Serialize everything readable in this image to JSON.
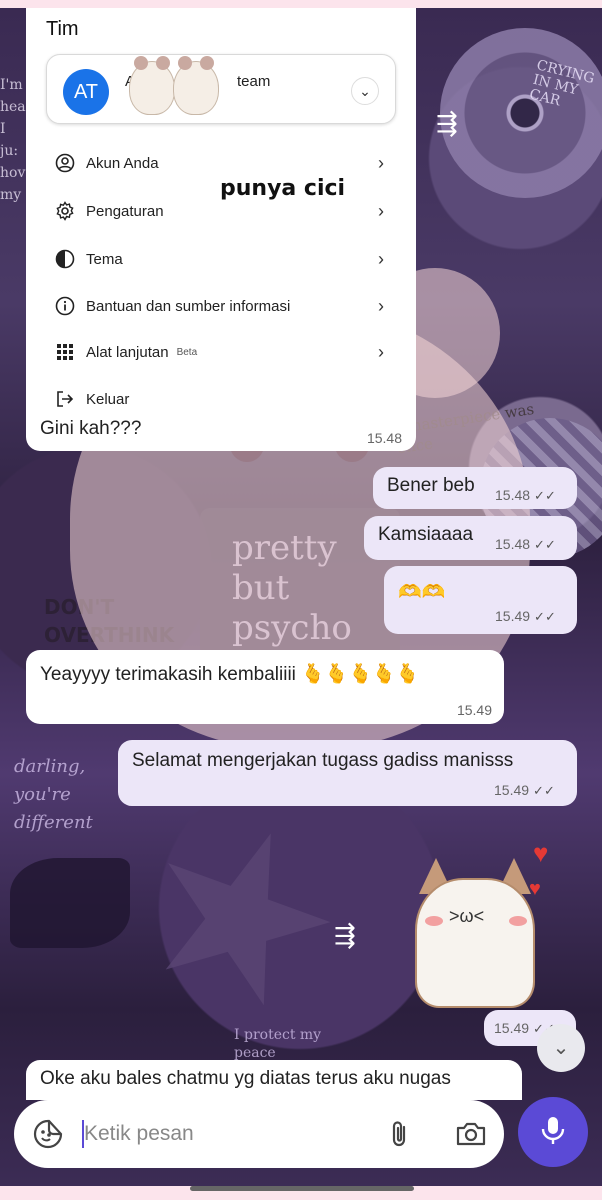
{
  "menu": {
    "title": "Tim",
    "account": {
      "initials": "AT",
      "name_visible": "A",
      "team_suffix": "team"
    },
    "overlay_text": "punya cici",
    "items": [
      {
        "label": "Akun Anda",
        "icon": "user-circle-icon"
      },
      {
        "label": "Pengaturan",
        "icon": "gear-icon"
      },
      {
        "label": "Tema",
        "icon": "half-circle-theme-icon"
      },
      {
        "label": "Bantuan dan sumber informasi",
        "icon": "info-icon"
      },
      {
        "label": "Alat lanjutan",
        "icon": "grid-icon",
        "badge": "Beta"
      },
      {
        "label": "Keluar",
        "icon": "logout-icon"
      }
    ]
  },
  "messages": [
    {
      "dir": "in",
      "text": "Gini kah???",
      "time": "15.48"
    },
    {
      "dir": "out",
      "text": "Bener beb",
      "time": "15.48"
    },
    {
      "dir": "out",
      "text": "Kamsiaaaa",
      "time": "15.48"
    },
    {
      "dir": "out",
      "text": "🫶🫶",
      "time": "15.49"
    },
    {
      "dir": "in",
      "text": "Yeayyyy terimakasih kembaliiii 🫰🫰🫰🫰🫰",
      "time": "15.49"
    },
    {
      "dir": "out",
      "text": "Selamat mengerjakan tugass gadiss manisss",
      "time": "15.49"
    },
    {
      "dir": "out-sticker",
      "text": "",
      "time": "15.49"
    },
    {
      "dir": "in",
      "text": "Oke aku bales chatmu yg diatas terus aku nugas",
      "time": ""
    }
  ],
  "ticks": "✓✓",
  "background_words": {
    "crying": "CRYING IN MY CAR",
    "pretty": "pretty but psycho",
    "dont": "DON'T OVERTHINK",
    "darling": "darling, you're different",
    "protect": "I protect my peace",
    "masterpiece": "y masterpiece was once",
    "side": "I'm hea I ju: hov my"
  },
  "input": {
    "placeholder": "Ketik pesan"
  },
  "colors": {
    "accent": "#5b4ad6",
    "avatar": "#1a73e8",
    "bubble_out": "#ece6f8",
    "bubble_in": "#ffffff"
  }
}
